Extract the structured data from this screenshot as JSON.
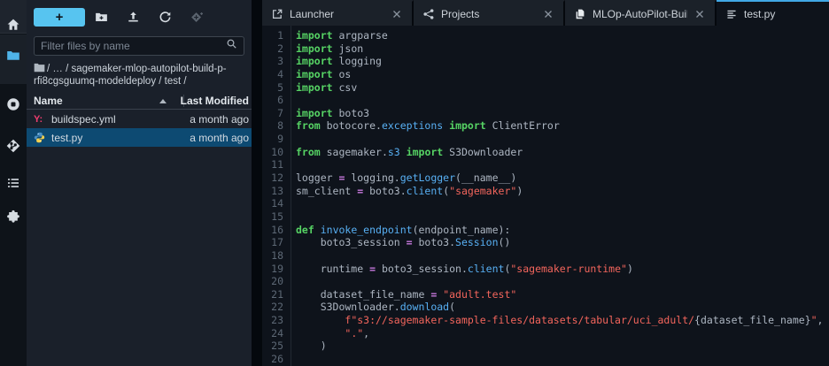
{
  "accent_colors": {
    "active_tab_border": "#41a8e6",
    "new_button": "#57c4f0",
    "selection": "#0d4a72",
    "folder_active": "#4fb3e8"
  },
  "activity_bar": {
    "items": [
      {
        "icon": "home",
        "name": "home"
      },
      {
        "icon": "folder",
        "name": "file-browser",
        "active": true
      },
      {
        "icon": "running",
        "name": "running-kernels"
      },
      {
        "icon": "git",
        "name": "git"
      },
      {
        "icon": "toc",
        "name": "table-of-contents"
      },
      {
        "icon": "puzzle",
        "name": "extensions"
      }
    ]
  },
  "sidebar": {
    "toolbar": {
      "new_launcher_label": "+",
      "icons": [
        {
          "icon": "new-folder",
          "name": "new-folder",
          "disabled": false
        },
        {
          "icon": "upload",
          "name": "upload-files",
          "disabled": false
        },
        {
          "icon": "refresh",
          "name": "refresh-file-list",
          "disabled": false
        },
        {
          "icon": "git-clone",
          "name": "git-clone",
          "disabled": true
        }
      ]
    },
    "filter": {
      "placeholder": "Filter files by name"
    },
    "breadcrumb": {
      "path_text": "/ … / sagemaker-mlop-autopilot-build-p-rfi8cgsguumq-modeldeploy / test /"
    },
    "files": {
      "columns": {
        "name": "Name",
        "modified": "Last Modified"
      },
      "sort": {
        "column": "Name",
        "direction": "ascending"
      },
      "rows": [
        {
          "icon": "yaml",
          "name": "buildspec.yml",
          "modified": "a month ago",
          "selected": false
        },
        {
          "icon": "python",
          "name": "test.py",
          "modified": "a month ago",
          "selected": true
        }
      ]
    },
    "yaml_glyph": "Y:"
  },
  "tabs": [
    {
      "icon": "launcher",
      "label": "Launcher",
      "active": false,
      "closable": true
    },
    {
      "icon": "share",
      "label": "Projects",
      "active": false,
      "closable": true
    },
    {
      "icon": "copy",
      "label": "MLOp-AutoPilot-Build",
      "active": false,
      "closable": true
    },
    {
      "icon": "text-editor",
      "label": "test.py",
      "active": true,
      "closable": false
    }
  ],
  "editor": {
    "language": "python",
    "lines": [
      {
        "n": 1,
        "t": [
          [
            "kw",
            "import"
          ],
          [
            "pl",
            " argparse"
          ]
        ]
      },
      {
        "n": 2,
        "t": [
          [
            "kw",
            "import"
          ],
          [
            "pl",
            " json"
          ]
        ]
      },
      {
        "n": 3,
        "t": [
          [
            "kw",
            "import"
          ],
          [
            "pl",
            " logging"
          ]
        ]
      },
      {
        "n": 4,
        "t": [
          [
            "kw",
            "import"
          ],
          [
            "pl",
            " os"
          ]
        ]
      },
      {
        "n": 5,
        "t": [
          [
            "kw",
            "import"
          ],
          [
            "pl",
            " csv"
          ]
        ]
      },
      {
        "n": 6,
        "t": []
      },
      {
        "n": 7,
        "t": [
          [
            "kw",
            "import"
          ],
          [
            "pl",
            " boto3"
          ]
        ]
      },
      {
        "n": 8,
        "t": [
          [
            "kw",
            "from"
          ],
          [
            "pl",
            " botocore."
          ],
          [
            "prop",
            "exceptions"
          ],
          [
            "pl",
            " "
          ],
          [
            "kw",
            "import"
          ],
          [
            "pl",
            " ClientError"
          ]
        ]
      },
      {
        "n": 9,
        "t": []
      },
      {
        "n": 10,
        "t": [
          [
            "kw",
            "from"
          ],
          [
            "pl",
            " sagemaker."
          ],
          [
            "prop",
            "s3"
          ],
          [
            "pl",
            " "
          ],
          [
            "kw",
            "import"
          ],
          [
            "pl",
            " S3Downloader"
          ]
        ]
      },
      {
        "n": 11,
        "t": []
      },
      {
        "n": 12,
        "t": [
          [
            "pl",
            "logger "
          ],
          [
            "op",
            "="
          ],
          [
            "pl",
            " logging."
          ],
          [
            "fn",
            "getLogger"
          ],
          [
            "pl",
            "(__name__)"
          ]
        ]
      },
      {
        "n": 13,
        "t": [
          [
            "pl",
            "sm_client "
          ],
          [
            "op",
            "="
          ],
          [
            "pl",
            " boto3."
          ],
          [
            "fn",
            "client"
          ],
          [
            "pl",
            "("
          ],
          [
            "str",
            "\"sagemaker\""
          ],
          [
            "pl",
            ")"
          ]
        ]
      },
      {
        "n": 14,
        "t": []
      },
      {
        "n": 15,
        "t": []
      },
      {
        "n": 16,
        "t": [
          [
            "kw",
            "def"
          ],
          [
            "pl",
            " "
          ],
          [
            "fn",
            "invoke_endpoint"
          ],
          [
            "pl",
            "(endpoint_name):"
          ]
        ]
      },
      {
        "n": 17,
        "t": [
          [
            "pl",
            "    boto3_session "
          ],
          [
            "op",
            "="
          ],
          [
            "pl",
            " boto3."
          ],
          [
            "fn",
            "Session"
          ],
          [
            "pl",
            "()"
          ]
        ]
      },
      {
        "n": 18,
        "t": []
      },
      {
        "n": 19,
        "t": [
          [
            "pl",
            "    runtime "
          ],
          [
            "op",
            "="
          ],
          [
            "pl",
            " boto3_session."
          ],
          [
            "fn",
            "client"
          ],
          [
            "pl",
            "("
          ],
          [
            "str",
            "\"sagemaker-runtime\""
          ],
          [
            "pl",
            ")"
          ]
        ]
      },
      {
        "n": 20,
        "t": []
      },
      {
        "n": 21,
        "t": [
          [
            "pl",
            "    dataset_file_name "
          ],
          [
            "op",
            "="
          ],
          [
            "pl",
            " "
          ],
          [
            "str",
            "\"adult.test\""
          ]
        ]
      },
      {
        "n": 22,
        "t": [
          [
            "pl",
            "    S3Downloader."
          ],
          [
            "fn",
            "download"
          ],
          [
            "pl",
            "("
          ]
        ]
      },
      {
        "n": 23,
        "t": [
          [
            "pl",
            "        "
          ],
          [
            "str",
            "f\"s3://sagemaker-sample-files/datasets/tabular/uci_adult/"
          ],
          [
            "pl",
            "{dataset_file_name}"
          ],
          [
            "str",
            "\""
          ],
          [
            "pl",
            ","
          ]
        ]
      },
      {
        "n": 24,
        "t": [
          [
            "pl",
            "        "
          ],
          [
            "str",
            "\".\""
          ],
          [
            "pl",
            ","
          ]
        ]
      },
      {
        "n": 25,
        "t": [
          [
            "pl",
            "    )"
          ]
        ]
      },
      {
        "n": 26,
        "t": []
      }
    ]
  }
}
